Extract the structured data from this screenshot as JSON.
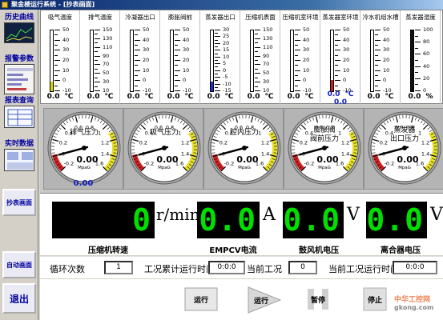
{
  "window": {
    "title": "聚金楼运行系统 - [抄表画面]"
  },
  "sidebar": {
    "items": [
      {
        "label": "历史曲线"
      },
      {
        "label": "报警参数"
      },
      {
        "label": "报表查询"
      },
      {
        "label": "实时数据"
      }
    ],
    "buttons": [
      {
        "label": "抄表画面"
      },
      {
        "label": "自动画面"
      },
      {
        "label": "退出"
      }
    ]
  },
  "thermometers": [
    {
      "name": "吸气温度",
      "ticks": [
        "50",
        "40",
        "30",
        "20",
        "10",
        "0",
        "-10"
      ],
      "value": "0.0",
      "unit": "℃",
      "level": 0.16,
      "color": "#d8d800"
    },
    {
      "name": "排气温度",
      "ticks": [
        "150",
        "130",
        "110",
        "90",
        "70",
        "50",
        "30",
        "10"
      ],
      "value": "0.0",
      "unit": "℃",
      "level": 0.0,
      "color": "#d8d800"
    },
    {
      "name": "冷凝器出口",
      "ticks": [
        "50",
        "40",
        "30",
        "20",
        "10",
        "0",
        "-10"
      ],
      "value": "0.0",
      "unit": "℃",
      "level": 0.0,
      "color": "#d8d800"
    },
    {
      "name": "膨胀阀前",
      "ticks": [
        "50",
        "40",
        "30",
        "20",
        "10",
        "0",
        "-10"
      ],
      "value": "0.0",
      "unit": "℃",
      "level": 0.0,
      "color": "#d8d800"
    },
    {
      "name": "蒸发器出口",
      "ticks": [
        "30",
        "25",
        "20",
        "15",
        "10",
        "5",
        "0",
        "-5",
        "-10",
        "-15"
      ],
      "value": "0.0",
      "unit": "℃",
      "level": 0.16,
      "color": "#2030d0"
    },
    {
      "name": "压缩机表面",
      "ticks": [
        "150",
        "130",
        "110",
        "90",
        "70",
        "50",
        "30",
        "10"
      ],
      "value": "0.0",
      "unit": "℃",
      "level": 0.0,
      "color": "#d8d800"
    },
    {
      "name": "压缩机室环境",
      "ticks": [
        "50",
        "40",
        "30",
        "20",
        "10",
        "0",
        "-10"
      ],
      "value": "0.0",
      "unit": "℃",
      "level": 0.0,
      "color": "#d8d800"
    },
    {
      "name": "蒸发器室环境",
      "ticks": [
        "50",
        "40",
        "30",
        "20",
        "10",
        "0",
        "-10"
      ],
      "value": "0.0",
      "unit": "℃",
      "value2": "0.0",
      "level": 0.18,
      "color": "#d02020"
    },
    {
      "name": "冷水机组水槽",
      "ticks": [
        "50",
        "40",
        "30",
        "20",
        "10",
        "0",
        "-10"
      ],
      "value": "0.0",
      "unit": "℃",
      "level": 0.0,
      "color": "#d8d800"
    },
    {
      "name": "蒸发器湿度",
      "ticks": [
        "100",
        "80",
        "60",
        "40",
        "20",
        "0"
      ],
      "value": "0.0",
      "unit": "%",
      "level": 1.0,
      "color": "#101010"
    }
  ],
  "gauges": [
    {
      "label1": "排气压力",
      "label2": "",
      "value": "0.00",
      "value2": "0.00",
      "unit": "MpaG",
      "pointer": 0.0
    },
    {
      "label1": "吸气压力",
      "label2": "",
      "value": "0.00",
      "unit": "MpaG",
      "pointer": 0.0
    },
    {
      "label1": "腔内压力",
      "label2": "",
      "value": "0.00",
      "unit": "MpaG",
      "pointer": 0.0
    },
    {
      "label1": "膨胀阀",
      "label2": "阀前压力",
      "value": "0.00",
      "unit": "MpaG",
      "pointer": 0.0
    },
    {
      "label1": "蒸发器",
      "label2": "出口压力",
      "value": "0.00",
      "unit": "MpaG",
      "pointer": 0.0
    }
  ],
  "gauge_ticks": [
    "-0.2",
    "0",
    "0.2",
    "0.4",
    "0.6",
    "0.8",
    "1",
    "1.2",
    "1.4",
    "1.6"
  ],
  "displays": [
    {
      "value": "0",
      "unit": "r/min",
      "label": "压缩机转速"
    },
    {
      "value": "0.0",
      "unit": "A",
      "label": "EMPCV电流"
    },
    {
      "value": "0.0",
      "unit": "V",
      "label": "鼓风机电压"
    },
    {
      "value": "0.0",
      "unit": "V",
      "label": "离合器电压"
    }
  ],
  "info": {
    "cycle_label": "循环次数",
    "cycle_value": "1",
    "total_time_label": "工况累计运行时间",
    "total_time_value": "0:0:0",
    "current_label": "当前工况",
    "current_value": "0",
    "current_time_label": "当前工况运行时间",
    "current_time_value": "0:0:0"
  },
  "controls": {
    "run1": "运行",
    "run2": "运行",
    "pause": "暂停",
    "stop": "停止"
  },
  "watermark": {
    "text": "中华工控网",
    "url": "gkong.com"
  }
}
